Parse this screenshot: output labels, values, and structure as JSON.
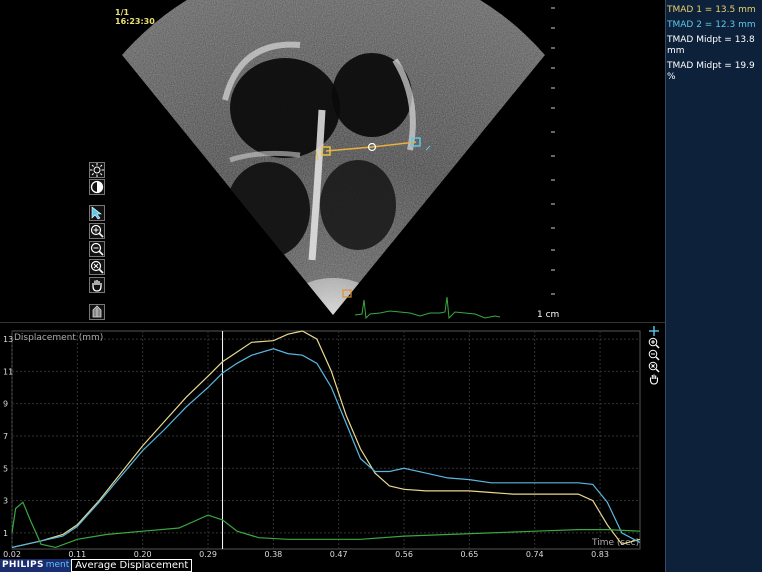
{
  "image": {
    "frame": "1/1",
    "time": "16:23:30",
    "scale_label": "1 cm"
  },
  "measurements": [
    {
      "text": "TMAD 1 = 13.5 mm",
      "color": "#e8d070"
    },
    {
      "text": "TMAD 2 = 12.3 mm",
      "color": "#5cc8e8"
    },
    {
      "text": "TMAD Midpt = 13.8 mm",
      "color": "#ffffff"
    },
    {
      "text": "TMAD Midpt = 19.9 %",
      "color": "#ffffff"
    }
  ],
  "tools": {
    "left": [
      "brightness-icon",
      "contrast-icon",
      "pointer-icon",
      "zoom-in-icon",
      "zoom-out-icon",
      "zoom-reset-icon",
      "pan-hand-icon",
      "print-icon"
    ],
    "graph": [
      "add-icon",
      "zoom-in-icon",
      "zoom-out-icon",
      "zoom-reset-icon",
      "pan-hand-icon"
    ]
  },
  "chart_data": {
    "type": "line",
    "ylabel": "Displacement (mm)",
    "xlabel": "Time (sec)",
    "xlim": [
      0.02,
      0.885
    ],
    "ylim": [
      0,
      13.5
    ],
    "x_ticks": [
      "0.02",
      "0.11",
      "0.20",
      "0.29",
      "0.38",
      "0.47",
      "0.56",
      "0.65",
      "0.74",
      "0.83"
    ],
    "y_ticks": [
      "1",
      "3",
      "5",
      "7",
      "9",
      "11",
      "13"
    ],
    "cursor_x": 0.31,
    "series": [
      {
        "color": "#e8d890",
        "x": [
          0.02,
          0.06,
          0.09,
          0.11,
          0.14,
          0.17,
          0.2,
          0.23,
          0.26,
          0.29,
          0.31,
          0.33,
          0.35,
          0.38,
          0.4,
          0.42,
          0.44,
          0.46,
          0.48,
          0.5,
          0.52,
          0.54,
          0.56,
          0.59,
          0.62,
          0.65,
          0.68,
          0.71,
          0.74,
          0.77,
          0.8,
          0.82,
          0.84,
          0.86,
          0.885
        ],
        "y": [
          0.1,
          0.5,
          0.9,
          1.5,
          3.0,
          4.7,
          6.4,
          7.9,
          9.4,
          10.7,
          11.6,
          12.2,
          12.8,
          12.9,
          13.3,
          13.5,
          13.0,
          11.0,
          8.3,
          6.2,
          4.7,
          3.9,
          3.7,
          3.6,
          3.6,
          3.6,
          3.5,
          3.4,
          3.4,
          3.4,
          3.4,
          3.0,
          1.5,
          0.3,
          0.6
        ]
      },
      {
        "color": "#5ab8e0",
        "x": [
          0.02,
          0.06,
          0.09,
          0.11,
          0.14,
          0.17,
          0.2,
          0.23,
          0.26,
          0.29,
          0.31,
          0.33,
          0.35,
          0.38,
          0.4,
          0.42,
          0.44,
          0.46,
          0.48,
          0.5,
          0.52,
          0.54,
          0.56,
          0.59,
          0.62,
          0.65,
          0.68,
          0.71,
          0.74,
          0.77,
          0.8,
          0.82,
          0.84,
          0.86,
          0.885
        ],
        "y": [
          0.1,
          0.5,
          0.8,
          1.4,
          2.9,
          4.5,
          6.1,
          7.4,
          8.8,
          10.0,
          10.9,
          11.5,
          12.0,
          12.4,
          12.1,
          12.0,
          11.5,
          10.0,
          7.8,
          5.6,
          4.8,
          4.8,
          5.0,
          4.7,
          4.4,
          4.3,
          4.1,
          4.1,
          4.1,
          4.1,
          4.1,
          4.0,
          2.9,
          1.0,
          0.4
        ]
      },
      {
        "color": "#3aa840",
        "x": [
          0.02,
          0.025,
          0.035,
          0.045,
          0.06,
          0.08,
          0.11,
          0.15,
          0.2,
          0.25,
          0.29,
          0.31,
          0.33,
          0.36,
          0.4,
          0.45,
          0.5,
          0.56,
          0.62,
          0.68,
          0.74,
          0.8,
          0.84,
          0.885
        ],
        "y": [
          1.0,
          2.5,
          2.9,
          1.8,
          0.3,
          0.1,
          0.6,
          0.9,
          1.1,
          1.3,
          2.1,
          1.8,
          1.1,
          0.7,
          0.6,
          0.6,
          0.6,
          0.8,
          0.9,
          1.0,
          1.1,
          1.2,
          1.2,
          1.1
        ]
      }
    ]
  },
  "bottom": {
    "brand": "PHILIPS",
    "brand_suffix": "ment",
    "tab": "Average Displacement"
  }
}
